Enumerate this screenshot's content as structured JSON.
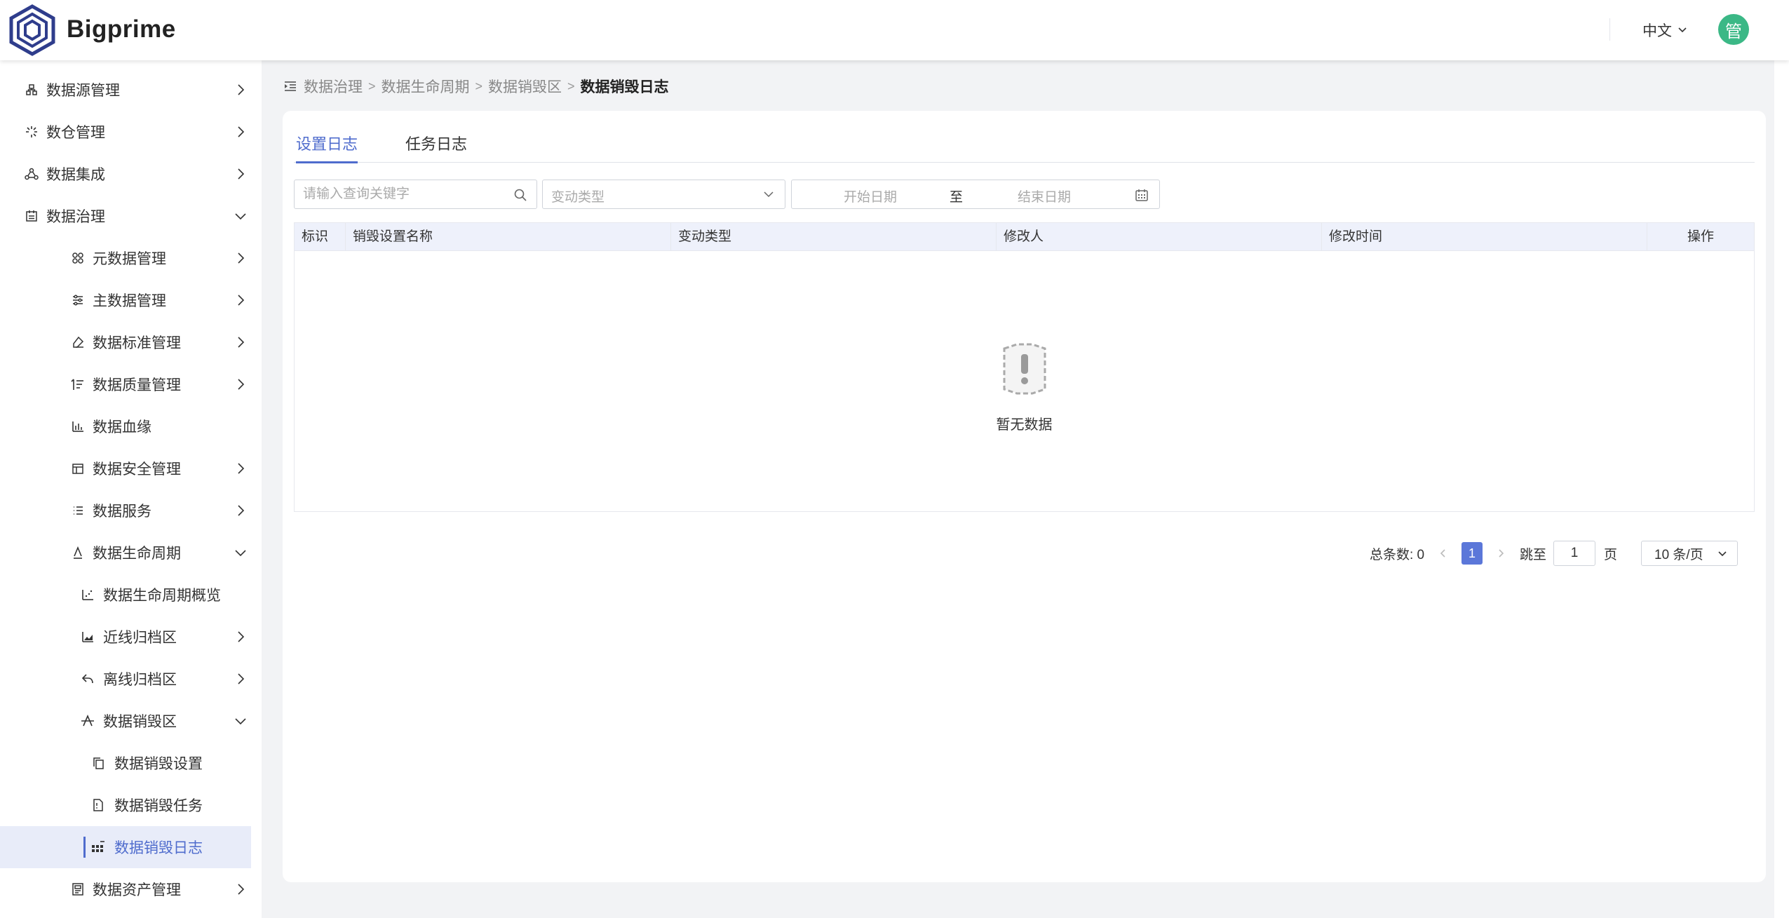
{
  "header": {
    "brand": "Bigprime",
    "language": "中文",
    "avatar_text": "管",
    "brand_color": "#2f3d8c",
    "avatar_color": "#3bb886"
  },
  "sidebar": {
    "items": [
      {
        "label": "数据源管理",
        "icon": "datasource-icon",
        "expanded": false
      },
      {
        "label": "数仓管理",
        "icon": "warehouse-icon",
        "expanded": false
      },
      {
        "label": "数据集成",
        "icon": "integration-icon",
        "expanded": false
      },
      {
        "label": "数据治理",
        "icon": "governance-icon",
        "expanded": true
      },
      {
        "label": "元数据管理",
        "icon": "metadata-icon",
        "expanded": false
      },
      {
        "label": "主数据管理",
        "icon": "masterdata-icon",
        "expanded": false
      },
      {
        "label": "数据标准管理",
        "icon": "standard-icon",
        "expanded": false
      },
      {
        "label": "数据质量管理",
        "icon": "quality-icon",
        "expanded": false
      },
      {
        "label": "数据血缘",
        "icon": "lineage-icon"
      },
      {
        "label": "数据安全管理",
        "icon": "security-icon",
        "expanded": false
      },
      {
        "label": "数据服务",
        "icon": "service-icon",
        "expanded": false
      },
      {
        "label": "数据生命周期",
        "icon": "lifecycle-icon",
        "expanded": true
      },
      {
        "label": "数据生命周期概览",
        "icon": "overview-icon"
      },
      {
        "label": "近线归档区",
        "icon": "nearline-icon",
        "expanded": false
      },
      {
        "label": "离线归档区",
        "icon": "offline-icon",
        "expanded": false
      },
      {
        "label": "数据销毁区",
        "icon": "destroy-icon",
        "expanded": true
      },
      {
        "label": "数据销毁设置",
        "icon": "copy-icon"
      },
      {
        "label": "数据销毁任务",
        "icon": "document-icon"
      },
      {
        "label": "数据销毁日志",
        "icon": "log-icon",
        "active": true
      },
      {
        "label": "数据资产管理",
        "icon": "asset-icon",
        "expanded": false
      }
    ]
  },
  "breadcrumb": {
    "items": [
      "数据治理",
      "数据生命周期",
      "数据销毁区"
    ],
    "current": "数据销毁日志"
  },
  "tabs": [
    {
      "label": "设置日志",
      "active": true
    },
    {
      "label": "任务日志",
      "active": false
    }
  ],
  "filters": {
    "keyword_placeholder": "请输入查询关键字",
    "change_type_placeholder": "变动类型",
    "start_date_placeholder": "开始日期",
    "date_separator": "至",
    "end_date_placeholder": "结束日期"
  },
  "table": {
    "columns": [
      "标识",
      "销毁设置名称",
      "变动类型",
      "修改人",
      "修改时间",
      "操作"
    ],
    "rows": [],
    "empty_text": "暂无数据"
  },
  "pagination": {
    "total_label": "总条数: 0",
    "current_page": "1",
    "jump_label": "跳至",
    "jump_value": "1",
    "page_suffix": "页",
    "page_size": "10 条/页"
  },
  "colors": {
    "accent": "#4f6ccd",
    "active_bg": "#e8ecf9",
    "table_header_bg": "#eef1fb"
  }
}
